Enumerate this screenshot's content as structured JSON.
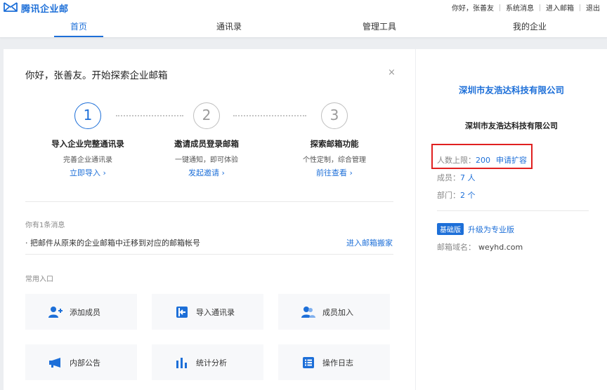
{
  "brand": {
    "name": "腾讯企业邮"
  },
  "toplinks": {
    "greeting": "你好，张善友",
    "system_msg": "系统消息",
    "enter_mail": "进入邮箱",
    "logout": "退出"
  },
  "nav": {
    "home": "首页",
    "contacts": "通讯录",
    "admin_tools": "管理工具",
    "my_company": "我的企业"
  },
  "welcome": {
    "greeting": "你好，张善友。开始探索企业邮箱",
    "close": "×",
    "steps": [
      {
        "num": "1",
        "title": "导入企业完整通讯录",
        "desc": "完善企业通讯录",
        "link": "立即导入 ›"
      },
      {
        "num": "2",
        "title": "邀请成员登录邮箱",
        "desc": "一键通知，即可体验",
        "link": "发起邀请 ›"
      },
      {
        "num": "3",
        "title": "探索邮箱功能",
        "desc": "个性定制，综合管理",
        "link": "前往查看 ›"
      }
    ]
  },
  "messages": {
    "header": "你有1条消息",
    "item": "· 把邮件从原来的企业邮箱中迁移到对应的邮箱帐号",
    "link": "进入邮箱搬家"
  },
  "shortcuts": {
    "header": "常用入口",
    "items": [
      {
        "label": "添加成员",
        "icon": "add-member-icon"
      },
      {
        "label": "导入通讯录",
        "icon": "import-contacts-icon"
      },
      {
        "label": "成员加入",
        "icon": "member-join-icon"
      },
      {
        "label": "内部公告",
        "icon": "megaphone-icon"
      },
      {
        "label": "统计分析",
        "icon": "bar-chart-icon"
      },
      {
        "label": "操作日志",
        "icon": "list-log-icon"
      }
    ]
  },
  "company": {
    "title": "深圳市友浩达科技有限公司",
    "subtitle": "深圳市友浩达科技有限公司",
    "limit_label": "人数上限：",
    "limit_value": "200",
    "expand": "申请扩容",
    "members_label": "成员：",
    "members_value": "7 人",
    "dept_label": "部门：",
    "dept_value": "2 个",
    "edition_badge": "基础版",
    "upgrade": "升级为专业版",
    "domain_label": "邮箱域名：",
    "domain_value": "weyhd.com"
  },
  "colors": {
    "accent": "#1d6fd8",
    "highlight": "#e02020"
  }
}
